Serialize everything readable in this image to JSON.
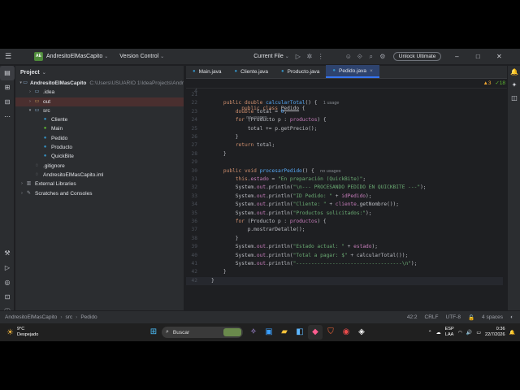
{
  "titlebar": {
    "project_badge": "AE",
    "project_name": "AndresitoElMasCapito",
    "version_control": "Version Control",
    "run_config": "Current File",
    "unlock_button": "Unlock Ultimate"
  },
  "project_panel": {
    "title": "Project",
    "tree": [
      {
        "label": "AndresitoElMasCapito",
        "path": "C:\\Users\\USUARIO 1\\IdeaProjects\\Andr",
        "type": "module",
        "depth": 0,
        "arrow": "▾",
        "bold": true
      },
      {
        "label": ".idea",
        "type": "folder",
        "depth": 1,
        "arrow": "›"
      },
      {
        "label": "out",
        "type": "folder-excluded",
        "depth": 1,
        "arrow": "›"
      },
      {
        "label": "src",
        "type": "folder",
        "depth": 1,
        "arrow": "▾"
      },
      {
        "label": "Cliente",
        "type": "class",
        "depth": 2,
        "arrow": ""
      },
      {
        "label": "Main",
        "type": "class-main",
        "depth": 2,
        "arrow": "",
        "selected": true
      },
      {
        "label": "Pedido",
        "type": "class",
        "depth": 2,
        "arrow": ""
      },
      {
        "label": "Producto",
        "type": "class",
        "depth": 2,
        "arrow": ""
      },
      {
        "label": "QuickBite",
        "type": "class",
        "depth": 2,
        "arrow": ""
      },
      {
        "label": ".gitignore",
        "type": "file",
        "depth": 1,
        "arrow": ""
      },
      {
        "label": "AndresitoElMasCapito.iml",
        "type": "file",
        "depth": 1,
        "arrow": ""
      },
      {
        "label": "External Libraries",
        "type": "lib",
        "depth": 0,
        "arrow": "›"
      },
      {
        "label": "Scratches and Consoles",
        "type": "scratch",
        "depth": 0,
        "arrow": "›"
      }
    ]
  },
  "tabs": [
    {
      "label": "Main.java",
      "active": false
    },
    {
      "label": "Cliente.java",
      "active": false
    },
    {
      "label": "Producto.java",
      "active": false
    },
    {
      "label": "Pedido.java",
      "active": true
    }
  ],
  "editor": {
    "sticky_line_number": "4",
    "sticky_keyword": "public class ",
    "sticky_class": "Pedido",
    "sticky_brace": " {",
    "sticky_hint": "no usages",
    "inspections_warnings": "▲3",
    "inspections_ok": "✓18",
    "lines": [
      {
        "n": "21",
        "html": ""
      },
      {
        "n": "22",
        "html": "    <span class='kw'>public double</span> <span class='fn'>calcularTotal</span>() {  <span class='hint'>1 usage</span>"
      },
      {
        "n": "23",
        "html": "        <span class='kw'>double</span> total = <span class='fn'>0</span>;"
      },
      {
        "n": "24",
        "html": "        <span class='kw'>for</span> (Producto p : <span class='fld'>productos</span>) {"
      },
      {
        "n": "25",
        "html": "            total += p.getPrecio();"
      },
      {
        "n": "26",
        "html": "        }"
      },
      {
        "n": "27",
        "html": "        <span class='kw'>return</span> total;"
      },
      {
        "n": "28",
        "html": "    }"
      },
      {
        "n": "29",
        "html": ""
      },
      {
        "n": "30",
        "html": "    <span class='kw'>public void</span> <span class='fn'>procesarPedido</span>() {  <span class='hint'>no usages</span>"
      },
      {
        "n": "31",
        "html": "        <span class='kw'>this</span>.<span class='fld'>estado</span> = <span class='str'>\"En preparación (QuickBite)\"</span>;"
      },
      {
        "n": "32",
        "html": "        System.<span class='fld'>out</span>.println(<span class='str'>\"\\n--- PROCESANDO PEDIDO EN QUICKBITE ---\"</span>);"
      },
      {
        "n": "33",
        "html": "        System.<span class='fld'>out</span>.println(<span class='str'>\"ID Pedido: \"</span> + <span class='fld'>idPedido</span>);"
      },
      {
        "n": "34",
        "html": "        System.<span class='fld'>out</span>.println(<span class='str'>\"Cliente: \"</span> + <span class='fld'>cliente</span>.getNombre());"
      },
      {
        "n": "35",
        "html": "        System.<span class='fld'>out</span>.println(<span class='str'>\"Productos solicitados:\"</span>);"
      },
      {
        "n": "36",
        "html": "        <span class='kw'>for</span> (Producto p : <span class='fld'>productos</span>) {"
      },
      {
        "n": "37",
        "html": "            p.mostrarDetalle();"
      },
      {
        "n": "38",
        "html": "        }"
      },
      {
        "n": "39",
        "html": "        System.<span class='fld'>out</span>.println(<span class='str'>\"Estado actual: \"</span> + <span class='fld'>estado</span>);"
      },
      {
        "n": "40",
        "html": "        System.<span class='fld'>out</span>.println(<span class='str'>\"Total a pagar: $\"</span> + calcularTotal());"
      },
      {
        "n": "41",
        "html": "        System.<span class='fld'>out</span>.println(<span class='str'>\"-----------------------------------\\n\"</span>);"
      },
      {
        "n": "42",
        "html": "    }"
      },
      {
        "n": "42",
        "html": "}",
        "cursor": true
      }
    ]
  },
  "statusbar": {
    "breadcrumb": [
      "AndresitoElMasCapito",
      "src",
      "Pedido"
    ],
    "position": "42:2",
    "line_sep": "CRLF",
    "encoding": "UTF-8",
    "indent": "4 spaces"
  },
  "taskbar": {
    "temp": "9°C",
    "weather": "Despejado",
    "search": "Buscar",
    "lang1": "ESP",
    "lang2": "LAA",
    "time": "0:36",
    "date": "22/7/2026"
  }
}
